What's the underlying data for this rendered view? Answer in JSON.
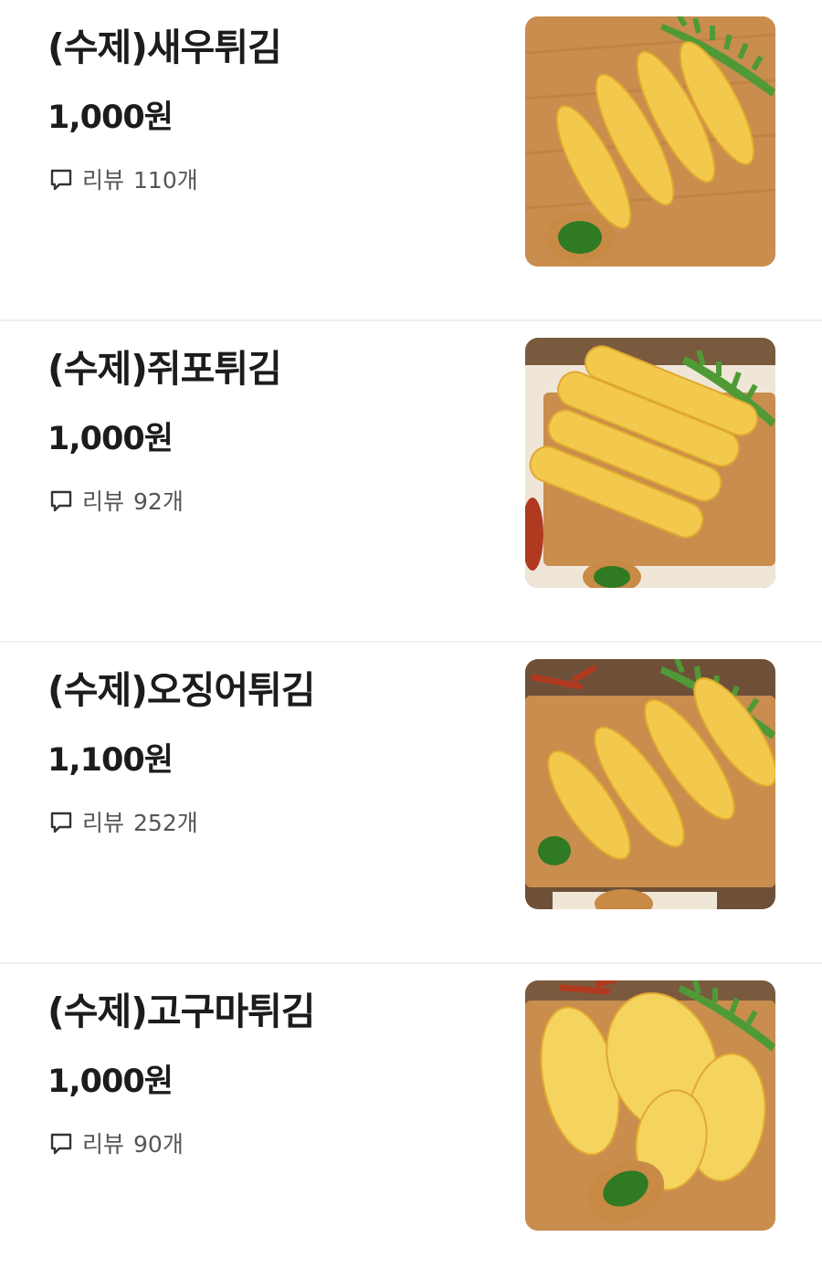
{
  "menu": {
    "items": [
      {
        "name": "(수제)새우튀김",
        "price": "1,000원",
        "review_label": "리뷰",
        "review_count": "110개",
        "image": "shrimp-tempura-photo"
      },
      {
        "name": "(수제)쥐포튀김",
        "price": "1,000원",
        "review_label": "리뷰",
        "review_count": "92개",
        "image": "filefish-tempura-photo"
      },
      {
        "name": "(수제)오징어튀김",
        "price": "1,100원",
        "review_label": "리뷰",
        "review_count": "252개",
        "image": "squid-tempura-photo"
      },
      {
        "name": "(수제)고구마튀김",
        "price": "1,000원",
        "review_label": "리뷰",
        "review_count": "90개",
        "image": "sweet-potato-tempura-photo"
      }
    ]
  },
  "icons": {
    "review": "chat-bubble-icon"
  },
  "colors": {
    "text": "#1c1c1c",
    "subtext": "#555555",
    "divider": "#f0f0f0",
    "board": "#c98d4e",
    "tempura": "#f2c94c"
  }
}
